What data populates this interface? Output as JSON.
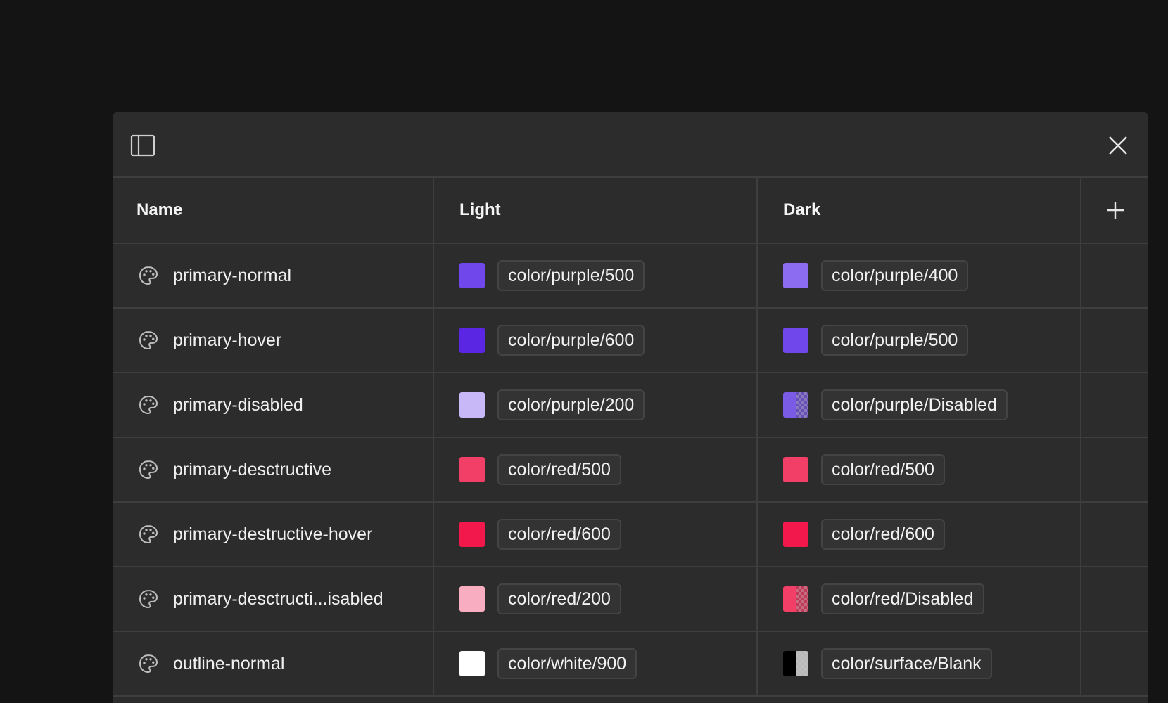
{
  "columns": {
    "name": "Name",
    "light": "Light",
    "dark": "Dark"
  },
  "rows": [
    {
      "name": "primary-normal",
      "light": {
        "label": "color/purple/500",
        "color": "#7047eb"
      },
      "dark": {
        "label": "color/purple/400",
        "color": "#8c6cf0"
      }
    },
    {
      "name": "primary-hover",
      "light": {
        "label": "color/purple/600",
        "color": "#5a26e3"
      },
      "dark": {
        "label": "color/purple/500",
        "color": "#7047eb"
      }
    },
    {
      "name": "primary-disabled",
      "light": {
        "label": "color/purple/200",
        "color": "#c9b8f7"
      },
      "dark": {
        "label": "color/purple/Disabled",
        "color": "#7a5be6",
        "alpha": true
      }
    },
    {
      "name": "primary-desctructive",
      "light": {
        "label": "color/red/500",
        "color": "#f23f68"
      },
      "dark": {
        "label": "color/red/500",
        "color": "#f23f68"
      }
    },
    {
      "name": "primary-destructive-hover",
      "light": {
        "label": "color/red/600",
        "color": "#f2184c"
      },
      "dark": {
        "label": "color/red/600",
        "color": "#f2184c"
      }
    },
    {
      "name": "primary-desctructi...isabled",
      "light": {
        "label": "color/red/200",
        "color": "#f9adc0"
      },
      "dark": {
        "label": "color/red/Disabled",
        "color": "#f23f68",
        "alpha": true
      }
    },
    {
      "name": "outline-normal",
      "light": {
        "label": "color/white/900",
        "color": "#ffffff"
      },
      "dark": {
        "label": "color/surface/Blank",
        "color": "#000000",
        "alpha": true
      }
    }
  ],
  "icons": {
    "sidebar": "sidebar-toggle-icon",
    "close": "close-icon",
    "add": "plus-icon",
    "variable": "palette-icon"
  },
  "theme": {
    "background": "#141414",
    "panel": "#2c2c2c",
    "border": "#3e3e3e"
  }
}
